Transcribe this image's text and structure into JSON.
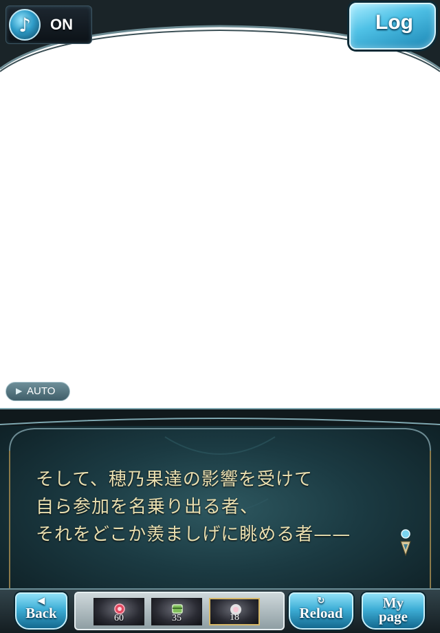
{
  "header": {
    "music_state": "ON",
    "log_label": "Log"
  },
  "auto": {
    "label": "AUTO"
  },
  "dialogue": {
    "lines": [
      "そして、穂乃果達の影響を受けて",
      "自ら参加を名乗り出る者、",
      "それをどこか羨ましげに眺める者——"
    ]
  },
  "footer": {
    "back_label": "Back",
    "reload_label": "Reload",
    "mypage_line1": "My",
    "mypage_line2": "page",
    "items": [
      {
        "count": "60",
        "icon": "red-gem-icon",
        "color": "#e0485f"
      },
      {
        "count": "35",
        "icon": "green-box-icon",
        "color": "#7fbf5a"
      },
      {
        "count": "18",
        "icon": "white-orb-icon",
        "color": "#f2f2f2"
      }
    ]
  },
  "colors": {
    "accent": "#3eaed6",
    "dialogue_text": "#e9dfb0",
    "dialogue_bg": "#1b3a42"
  }
}
